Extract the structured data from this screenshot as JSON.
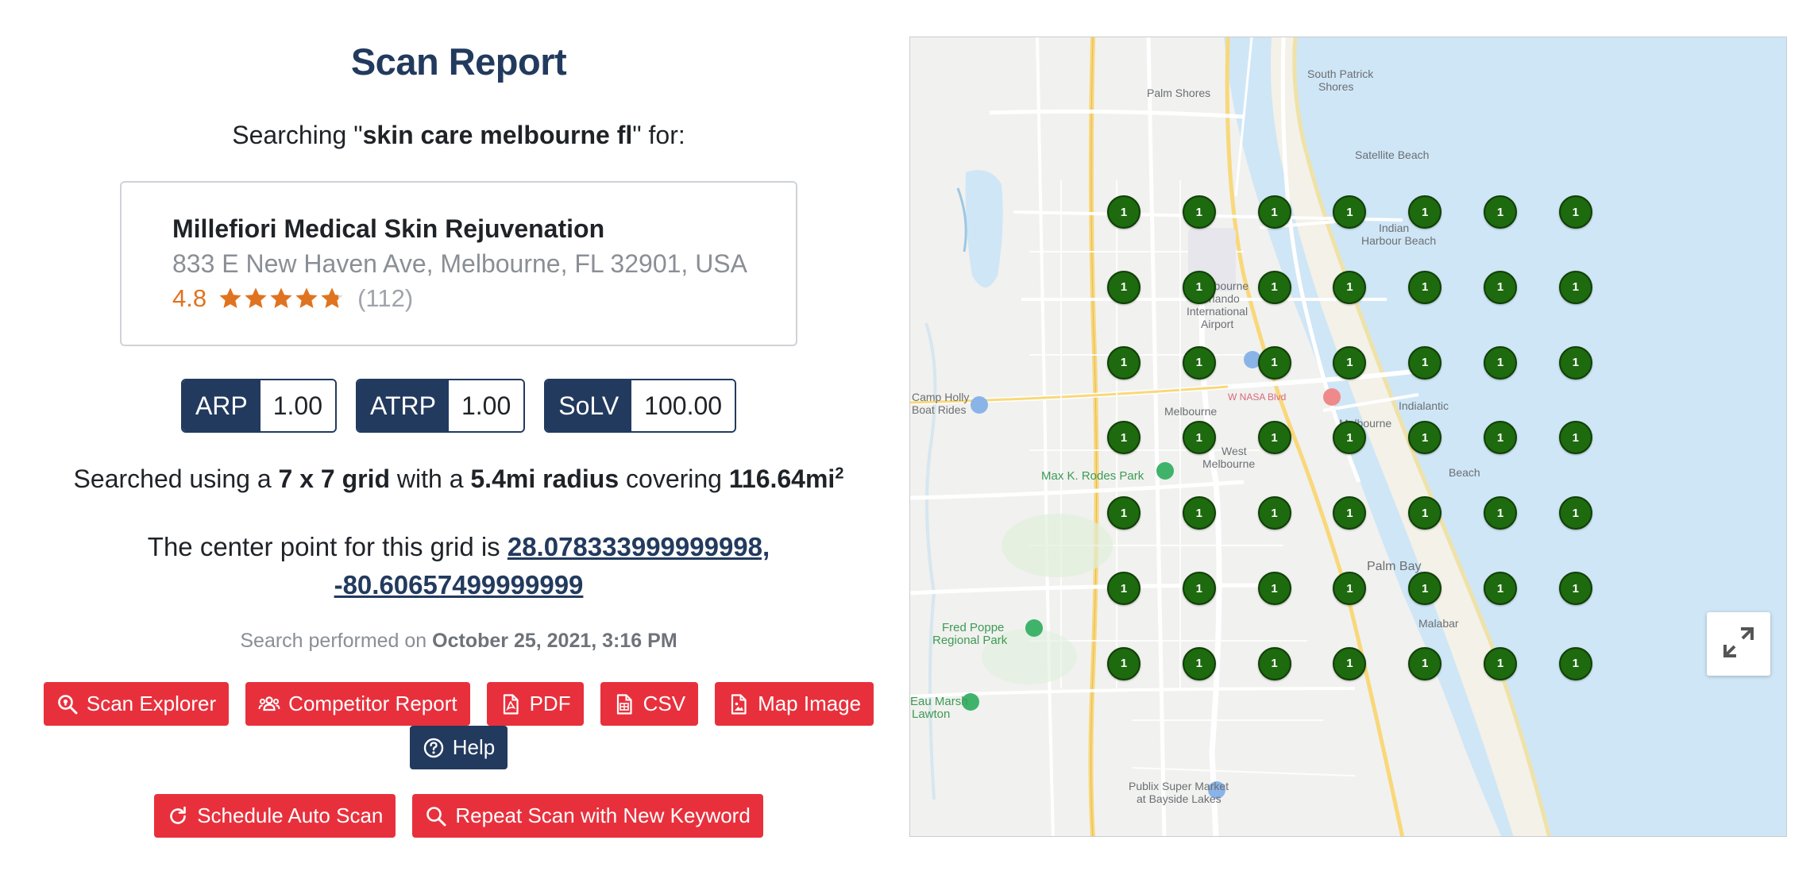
{
  "report": {
    "title": "Scan Report",
    "searching_prefix": "Searching \"",
    "keyword": "skin care melbourne fl",
    "searching_suffix": "\" for:"
  },
  "business": {
    "name": "Millefiori Medical Skin Rejuvenation",
    "address": "833 E New Haven Ave, Melbourne, FL 32901, USA",
    "rating": "4.8",
    "rating_value": 4.8,
    "stars_max": 5,
    "review_count": "(112)",
    "star_color": "#e07320"
  },
  "metrics": [
    {
      "label": "ARP",
      "value": "1.00"
    },
    {
      "label": "ATRP",
      "value": "1.00"
    },
    {
      "label": "SoLV",
      "value": "100.00"
    }
  ],
  "grid": {
    "prefix": "Searched using a ",
    "size": "7 x 7 grid",
    "mid": " with a ",
    "radius": "5.4mi radius",
    "mid2": " covering ",
    "area": "116.64mi",
    "area_exp": "2"
  },
  "center": {
    "prefix": "The center point for this grid is ",
    "coords_line1": "28.078333999999998,",
    "coords_line2": "-80.60657499999999"
  },
  "performed": {
    "prefix": "Search performed on ",
    "datetime": "October 25, 2021, 3:16 PM"
  },
  "buttons": {
    "scan_explorer": "Scan Explorer",
    "competitor_report": "Competitor Report",
    "pdf": "PDF",
    "csv": "CSV",
    "map_image": "Map Image",
    "help": "Help",
    "schedule_auto_scan": "Schedule Auto Scan",
    "repeat_scan": "Repeat Scan with New Keyword"
  },
  "map": {
    "grid_rank_value": "1",
    "pin_color": "#1e6a0f",
    "water_color": "#cfe6f6",
    "labels": [
      {
        "text": "Palm Shores",
        "kind": "normal"
      },
      {
        "text": "South Patrick",
        "kind": "normal"
      },
      {
        "text": "Shores",
        "kind": "normal"
      },
      {
        "text": "Satellite Beach",
        "kind": "normal"
      },
      {
        "text": "Indian",
        "kind": "normal"
      },
      {
        "text": "Harbour Beach",
        "kind": "normal"
      },
      {
        "text": "Melbourne",
        "kind": "normal"
      },
      {
        "text": "Orlando",
        "kind": "normal"
      },
      {
        "text": "International",
        "kind": "normal"
      },
      {
        "text": "Airport",
        "kind": "normal"
      },
      {
        "text": "W NASA Blvd",
        "kind": "pink"
      },
      {
        "text": "Indialantic",
        "kind": "normal"
      },
      {
        "text": "Melbourne",
        "kind": "normal"
      },
      {
        "text": "West",
        "kind": "normal"
      },
      {
        "text": "Melbourne",
        "kind": "normal"
      },
      {
        "text": "Melbourne",
        "kind": "normal"
      },
      {
        "text": "Beach",
        "kind": "normal"
      },
      {
        "text": "Max K. Rodes Park",
        "kind": "green"
      },
      {
        "text": "Palm Bay",
        "kind": "normal"
      },
      {
        "text": "Fred Poppe",
        "kind": "green"
      },
      {
        "text": "Regional Park",
        "kind": "green"
      },
      {
        "text": "Malabar",
        "kind": "normal"
      },
      {
        "text": "Camp Holly",
        "kind": "normal"
      },
      {
        "text": "Boat Rides",
        "kind": "normal"
      },
      {
        "text": "Publix Super Market",
        "kind": "normal"
      },
      {
        "text": "at Bayside Lakes",
        "kind": "normal"
      },
      {
        "text": "Eau Marsh",
        "kind": "green"
      },
      {
        "text": "Lawton",
        "kind": "green"
      }
    ]
  }
}
